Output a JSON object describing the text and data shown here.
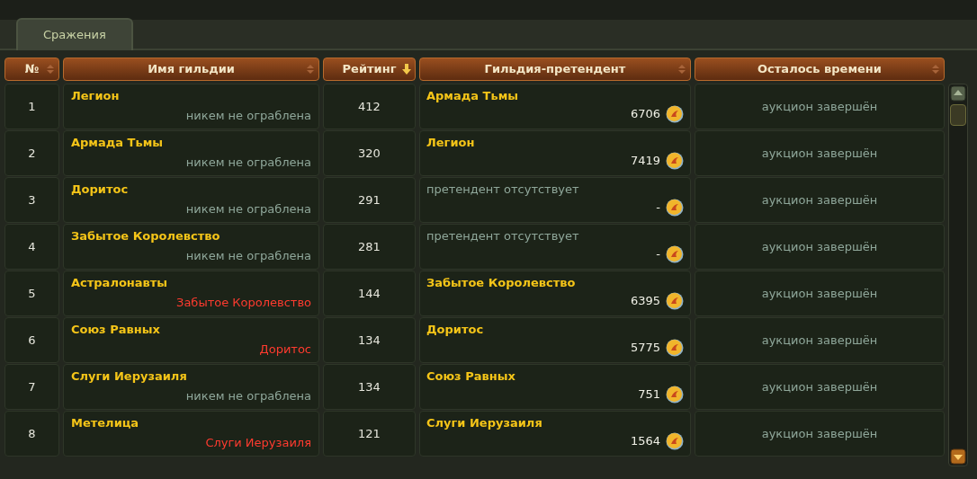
{
  "tabs": [
    {
      "label": "Сражения",
      "selected": true
    }
  ],
  "table": {
    "columns": [
      {
        "label": "№",
        "sorted": false
      },
      {
        "label": "Имя гильдии",
        "sorted": false
      },
      {
        "label": "Рейтинг",
        "sorted": true
      },
      {
        "label": "Гильдия-претендент",
        "sorted": false
      },
      {
        "label": "Осталось времени",
        "sorted": false
      }
    ],
    "rows": [
      {
        "rank": "1",
        "guild": "Легион",
        "status": "никем не ограблена",
        "robbed": false,
        "rating": "412",
        "challenger": "Армада Тьмы",
        "has_challenger": true,
        "bid": "6706",
        "time": "аукцион завершён"
      },
      {
        "rank": "2",
        "guild": "Армада Тьмы",
        "status": "никем не ограблена",
        "robbed": false,
        "rating": "320",
        "challenger": "Легион",
        "has_challenger": true,
        "bid": "7419",
        "time": "аукцион завершён"
      },
      {
        "rank": "3",
        "guild": "Доритос",
        "status": "никем не ограблена",
        "robbed": false,
        "rating": "291",
        "challenger": "претендент отсутствует",
        "has_challenger": false,
        "bid": "-",
        "time": "аукцион завершён"
      },
      {
        "rank": "4",
        "guild": "Забытое Королевство",
        "status": "никем не ограблена",
        "robbed": false,
        "rating": "281",
        "challenger": "претендент отсутствует",
        "has_challenger": false,
        "bid": "-",
        "time": "аукцион завершён"
      },
      {
        "rank": "5",
        "guild": "Астралонавты",
        "status": "Забытое Королевство",
        "robbed": true,
        "rating": "144",
        "challenger": "Забытое Королевство",
        "has_challenger": true,
        "bid": "6395",
        "time": "аукцион завершён"
      },
      {
        "rank": "6",
        "guild": "Союз Равных",
        "status": "Доритос",
        "robbed": true,
        "rating": "134",
        "challenger": "Доритос",
        "has_challenger": true,
        "bid": "5775",
        "time": "аукцион завершён"
      },
      {
        "rank": "7",
        "guild": "Слуги Иерузаиля",
        "status": "никем не ограблена",
        "robbed": false,
        "rating": "134",
        "challenger": "Союз Равных",
        "has_challenger": true,
        "bid": "751",
        "time": "аукцион завершён"
      },
      {
        "rank": "8",
        "guild": "Метелица",
        "status": "Слуги Иерузаиля",
        "robbed": true,
        "rating": "121",
        "challenger": "Слуги Иерузаиля",
        "has_challenger": true,
        "bid": "1564",
        "time": "аукцион завершён"
      }
    ]
  }
}
